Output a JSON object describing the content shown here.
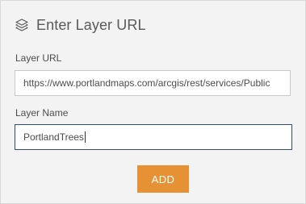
{
  "header": {
    "icon": "layers-icon",
    "title": "Enter Layer URL"
  },
  "layer_url": {
    "label": "Layer URL",
    "value": "https://www.portlandmaps.com/arcgis/rest/services/Public"
  },
  "layer_name": {
    "label": "Layer Name",
    "value": "PortlandTrees"
  },
  "add_button": {
    "label": "ADD",
    "color": "#e69234"
  }
}
